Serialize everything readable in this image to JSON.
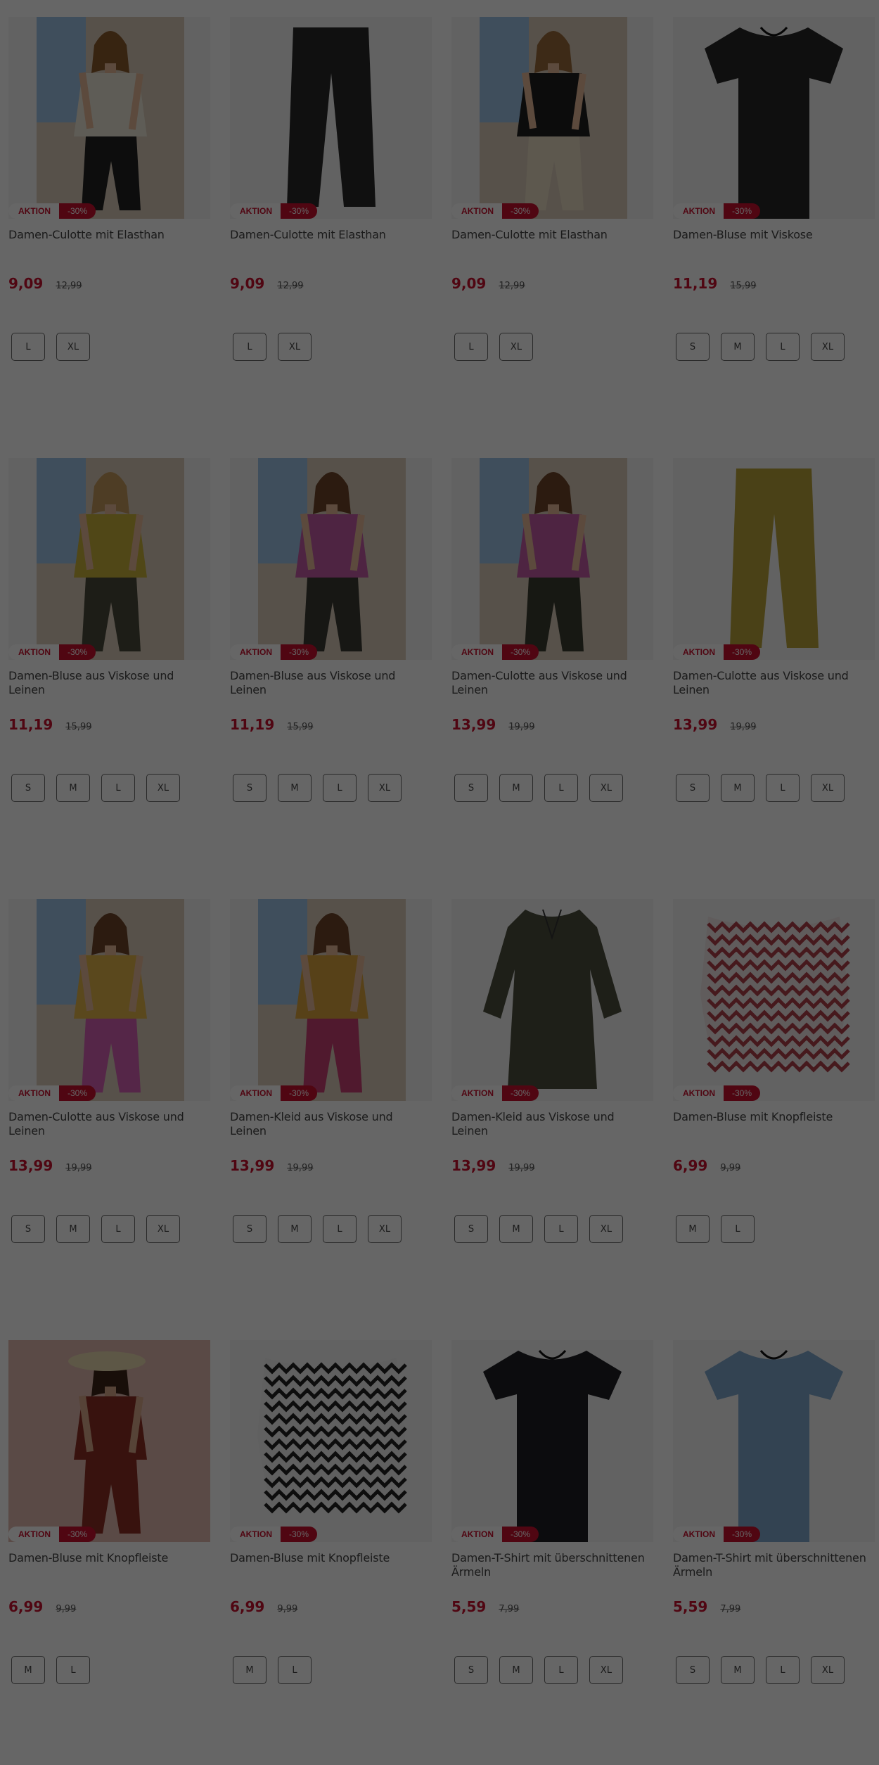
{
  "products": [
    {
      "title": "Damen-Culotte mit Elasthan",
      "badge": "AKTION",
      "discount": "-30%",
      "price": "9,09",
      "old_price": "12,99",
      "sizes": [
        "L",
        "XL"
      ],
      "image": "woman-beige-top-striped-culotte"
    },
    {
      "title": "Damen-Culotte mit Elasthan",
      "badge": "AKTION",
      "discount": "-30%",
      "price": "9,09",
      "old_price": "12,99",
      "sizes": [
        "L",
        "XL"
      ],
      "image": "black-culotte-pants"
    },
    {
      "title": "Damen-Culotte mit Elasthan",
      "badge": "AKTION",
      "discount": "-30%",
      "price": "9,09",
      "old_price": "12,99",
      "sizes": [
        "L",
        "XL"
      ],
      "image": "woman-black-tunic-beige-culotte"
    },
    {
      "title": "Damen-Bluse mit Viskose",
      "badge": "AKTION",
      "discount": "-30%",
      "price": "11,19",
      "old_price": "15,99",
      "sizes": [
        "S",
        "M",
        "L",
        "XL"
      ],
      "image": "black-blouse"
    },
    {
      "title": "Damen-Bluse aus Viskose und Leinen",
      "badge": "AKTION",
      "discount": "-30%",
      "price": "11,19",
      "old_price": "15,99",
      "sizes": [
        "S",
        "M",
        "L",
        "XL"
      ],
      "image": "woman-yellow-blouse"
    },
    {
      "title": "Damen-Bluse aus Viskose und Leinen",
      "badge": "AKTION",
      "discount": "-30%",
      "price": "11,19",
      "old_price": "15,99",
      "sizes": [
        "S",
        "M",
        "L",
        "XL"
      ],
      "image": "woman-pink-blouse"
    },
    {
      "title": "Damen-Culotte aus Viskose und Leinen",
      "badge": "AKTION",
      "discount": "-30%",
      "price": "13,99",
      "old_price": "19,99",
      "sizes": [
        "S",
        "M",
        "L",
        "XL"
      ],
      "image": "woman-pink-top-dark-culotte"
    },
    {
      "title": "Damen-Culotte aus Viskose und Leinen",
      "badge": "AKTION",
      "discount": "-30%",
      "price": "13,99",
      "old_price": "19,99",
      "sizes": [
        "S",
        "M",
        "L",
        "XL"
      ],
      "image": "yellow-culotte-pants"
    },
    {
      "title": "Damen-Culotte aus Viskose und Leinen",
      "badge": "AKTION",
      "discount": "-30%",
      "price": "13,99",
      "old_price": "19,99",
      "sizes": [
        "S",
        "M",
        "L",
        "XL"
      ],
      "image": "woman-pink-culotte"
    },
    {
      "title": "Damen-Kleid aus Viskose und Leinen",
      "badge": "AKTION",
      "discount": "-30%",
      "price": "13,99",
      "old_price": "19,99",
      "sizes": [
        "S",
        "M",
        "L",
        "XL"
      ],
      "image": "woman-patterned-dress"
    },
    {
      "title": "Damen-Kleid aus Viskose und Leinen",
      "badge": "AKTION",
      "discount": "-30%",
      "price": "13,99",
      "old_price": "19,99",
      "sizes": [
        "S",
        "M",
        "L",
        "XL"
      ],
      "image": "olive-dress"
    },
    {
      "title": "Damen-Bluse mit Knopfleiste",
      "badge": "AKTION",
      "discount": "-30%",
      "price": "6,99",
      "old_price": "9,99",
      "sizes": [
        "M",
        "L"
      ],
      "image": "red-chevron-blouse"
    },
    {
      "title": "Damen-Bluse mit Knopfleiste",
      "badge": "AKTION",
      "discount": "-30%",
      "price": "6,99",
      "old_price": "9,99",
      "sizes": [
        "M",
        "L"
      ],
      "image": "woman-red-blouse-hat"
    },
    {
      "title": "Damen-Bluse mit Knopfleiste",
      "badge": "AKTION",
      "discount": "-30%",
      "price": "6,99",
      "old_price": "9,99",
      "sizes": [
        "M",
        "L"
      ],
      "image": "black-white-chevron-blouse"
    },
    {
      "title": "Damen-T-Shirt mit überschnittenen Ärmeln",
      "badge": "AKTION",
      "discount": "-30%",
      "price": "5,59",
      "old_price": "7,99",
      "sizes": [
        "S",
        "M",
        "L",
        "XL"
      ],
      "image": "black-tshirt"
    },
    {
      "title": "Damen-T-Shirt mit überschnittenen Ärmeln",
      "badge": "AKTION",
      "discount": "-30%",
      "price": "5,59",
      "old_price": "7,99",
      "sizes": [
        "S",
        "M",
        "L",
        "XL"
      ],
      "image": "blue-tshirt"
    }
  ],
  "colors": {
    "sale_red": "#c8102e",
    "overlay": "rgba(0,0,0,0.6)"
  }
}
